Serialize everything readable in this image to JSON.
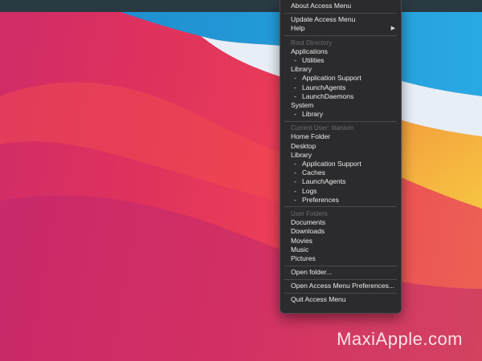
{
  "watermark": "MaxiApple.com",
  "menu": {
    "about": "About Access Menu",
    "update": "Update Access Menu",
    "help": "Help",
    "root_header": "Root Directory",
    "applications": "Applications",
    "utilities": "Utilities",
    "library": "Library",
    "application_support": "Application Support",
    "launch_agents": "LaunchAgents",
    "launch_daemons": "LaunchDaemons",
    "system": "System",
    "system_library": "Library",
    "user_header": "Current User: titanium",
    "home_folder": "Home Folder",
    "desktop": "Desktop",
    "user_library": "Library",
    "user_application_support": "Application Support",
    "caches": "Caches",
    "user_launch_agents": "LaunchAgents",
    "logs": "Logs",
    "preferences": "Preferences",
    "folders_header": "User Folders",
    "documents": "Documents",
    "downloads": "Downloads",
    "movies": "Movies",
    "music": "Music",
    "pictures": "Pictures",
    "open_folder": "Open folder...",
    "open_prefs": "Open Access Menu Preferences...",
    "quit": "Quit Access Menu",
    "submenu_arrow": "▶",
    "dash": "-"
  }
}
